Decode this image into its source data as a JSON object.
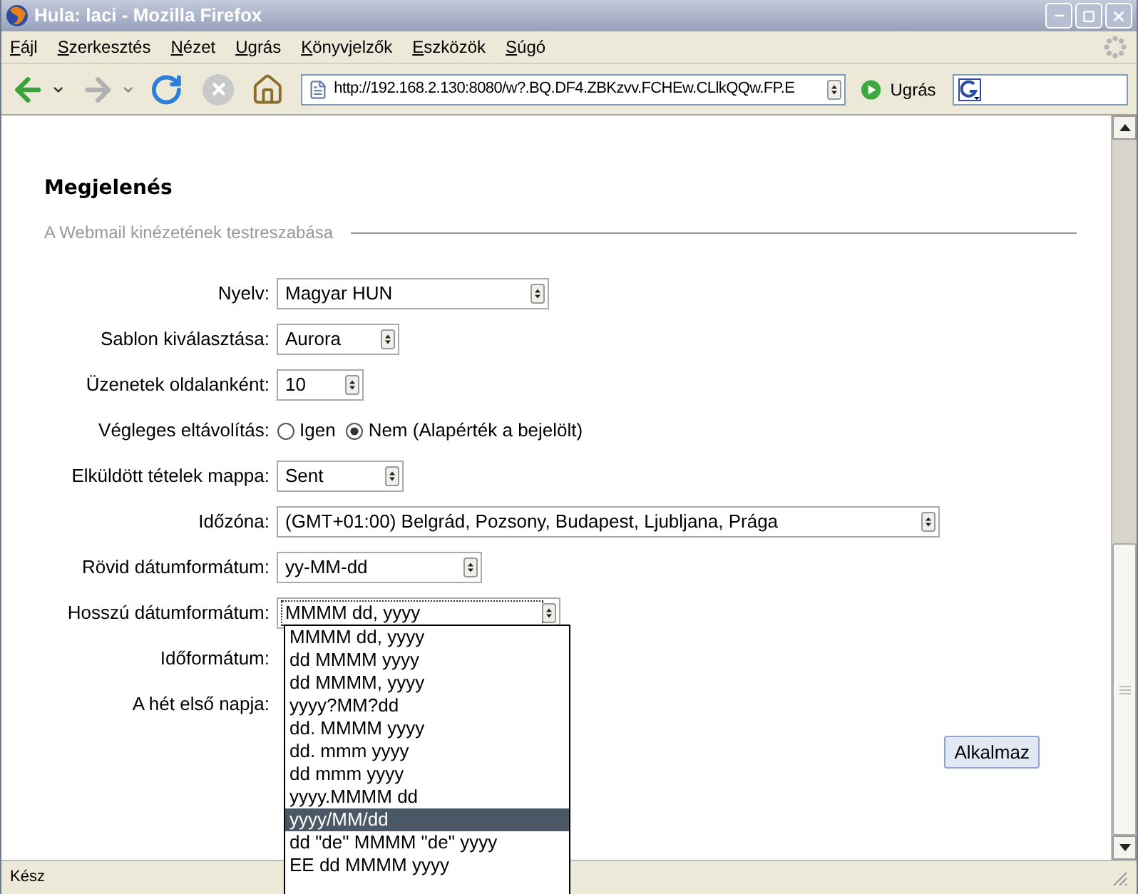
{
  "window": {
    "title": "Hula: laci - Mozilla Firefox"
  },
  "menu": [
    "Fájl",
    "Szerkesztés",
    "Nézet",
    "Ugrás",
    "Könyvjelzők",
    "Eszközök",
    "Súgó"
  ],
  "toolbar": {
    "url": "http://192.168.2.130:8080/w?.BQ.DF4.ZBKzvv.FCHEw.CLlkQQw.FP.E",
    "go_label": "Ugrás"
  },
  "page": {
    "heading": "Megjelenés",
    "subtitle": "A Webmail kinézetének testreszabása",
    "fields": [
      {
        "label": "Nyelv:",
        "kind": "select",
        "value": "Magyar HUN"
      },
      {
        "label": "Sablon kiválasztása:",
        "kind": "select",
        "value": "Aurora"
      },
      {
        "label": "Üzenetek oldalanként:",
        "kind": "select",
        "value": "10"
      },
      {
        "label": "Végleges eltávolítás:",
        "kind": "radio",
        "options": [
          {
            "label": "Igen",
            "selected": false
          },
          {
            "label": "Nem (Alapérték a bejelölt)",
            "selected": true
          }
        ]
      },
      {
        "label": "Elküldött tételek mappa:",
        "kind": "select",
        "value": "Sent"
      },
      {
        "label": "Időzóna:",
        "kind": "select",
        "value": "(GMT+01:00) Belgrád, Pozsony, Budapest, Ljubljana, Prága"
      },
      {
        "label": "Rövid dátumformátum:",
        "kind": "select",
        "value": "yy-MM-dd"
      },
      {
        "label": "Hosszú dátumformátum:",
        "kind": "select",
        "value": "MMMM dd, yyyy",
        "focused": true
      },
      {
        "label": "Időformátum:",
        "kind": "label"
      },
      {
        "label": "A hét első napja:",
        "kind": "label"
      }
    ],
    "apply_button": "Alkalmaz"
  },
  "dropdown": {
    "items": [
      {
        "label": "MMMM dd, yyyy",
        "selected": false
      },
      {
        "label": "dd MMMM yyyy",
        "selected": false
      },
      {
        "label": "dd MMMM, yyyy",
        "selected": false
      },
      {
        "label": "yyyy?MM?dd",
        "selected": false
      },
      {
        "label": "dd. MMMM yyyy",
        "selected": false
      },
      {
        "label": "dd. mmm yyyy",
        "selected": false
      },
      {
        "label": "dd mmm yyyy",
        "selected": false
      },
      {
        "label": "yyyy.MMMM dd",
        "selected": false
      },
      {
        "label": "yyyy/MM/dd",
        "selected": true
      },
      {
        "label": "dd \"de\" MMMM \"de\" yyyy",
        "selected": false
      },
      {
        "label": "EE dd MMMM yyyy",
        "selected": false
      }
    ]
  },
  "status_bar": {
    "text": "Kész"
  }
}
